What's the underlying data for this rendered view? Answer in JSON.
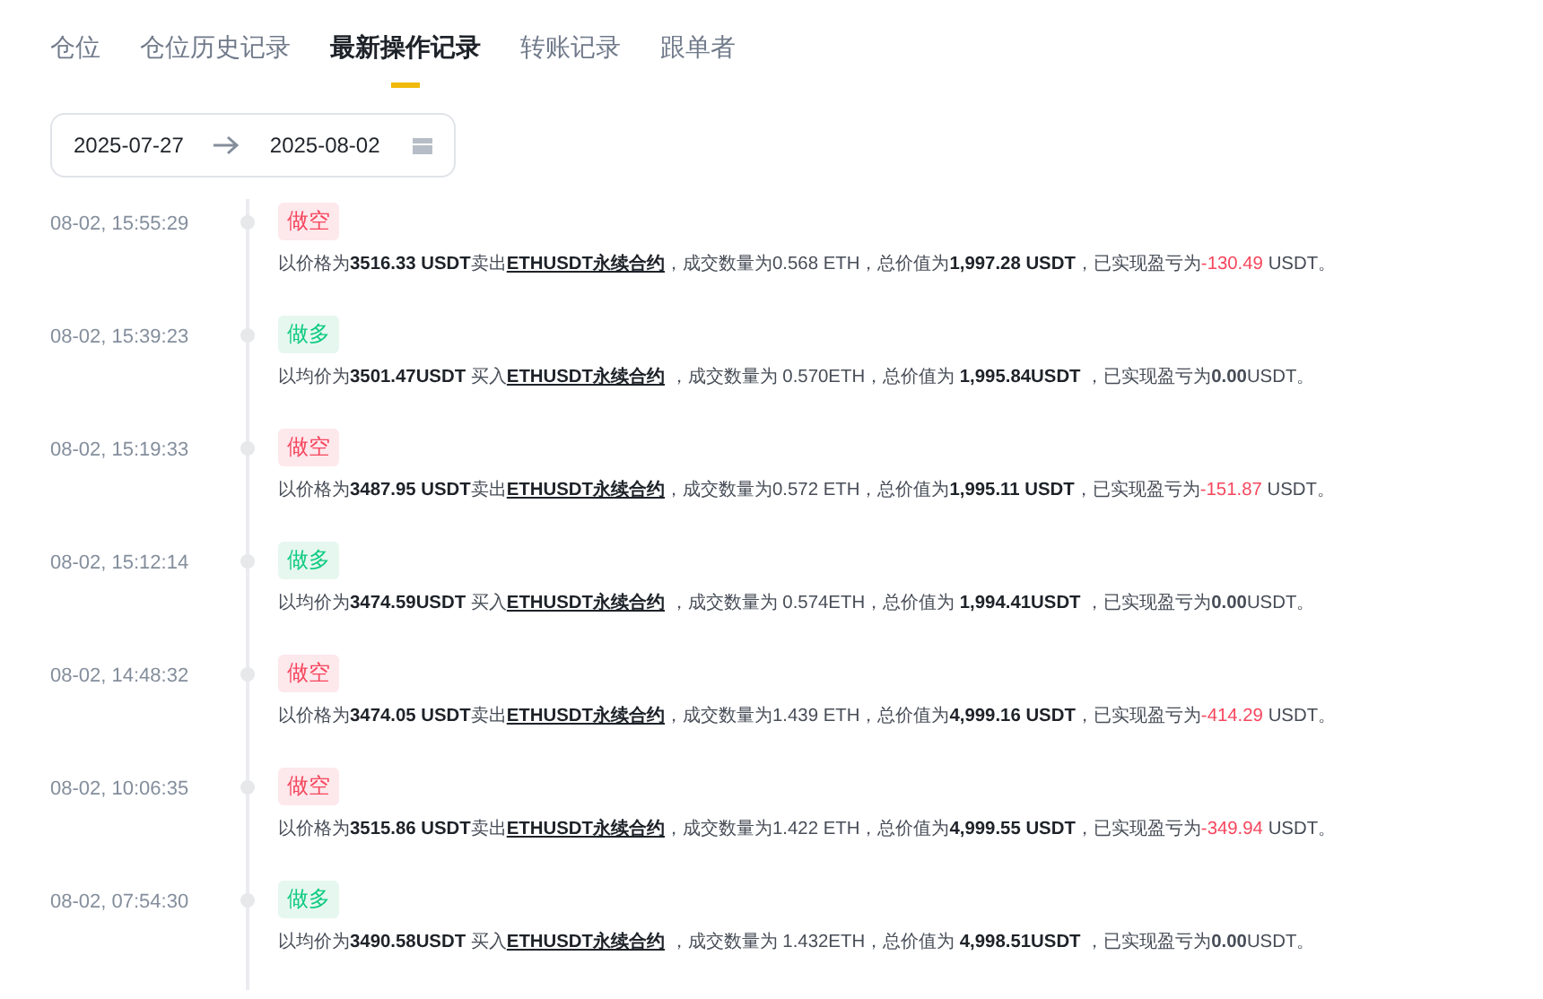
{
  "tabs": [
    {
      "label": "仓位",
      "selected": false
    },
    {
      "label": "仓位历史记录",
      "selected": false
    },
    {
      "label": "最新操作记录",
      "selected": true
    },
    {
      "label": "转账记录",
      "selected": false
    },
    {
      "label": "跟单者",
      "selected": false
    }
  ],
  "date_range": {
    "start": "2025-07-27",
    "end": "2025-08-02"
  },
  "records": [
    {
      "time": "08-02, 15:55:29",
      "kind": "short",
      "tag": "做空",
      "before": "以价格为**3516.33 USDT**卖出",
      "link": "ETHUSDT永续合约",
      "middle": "，成交数量为0.568 ETH，总价值为**1,997.28 USDT**，已实现盈亏为",
      "pnl": "-130.49",
      "loss": true,
      "after": " USDT。"
    },
    {
      "time": "08-02, 15:39:23",
      "kind": "long",
      "tag": "做多",
      "before": "以均价为**3501.47USDT** 买入",
      "link": "ETHUSDT永续合约",
      "middle": " ，成交数量为 0.570ETH，总价值为 **1,995.84USDT** ，已实现盈亏为",
      "pnl": "0.00",
      "loss": false,
      "after": "USDT。"
    },
    {
      "time": "08-02, 15:19:33",
      "kind": "short",
      "tag": "做空",
      "before": "以价格为**3487.95 USDT**卖出",
      "link": "ETHUSDT永续合约",
      "middle": "，成交数量为0.572 ETH，总价值为**1,995.11 USDT**，已实现盈亏为",
      "pnl": "-151.87",
      "loss": true,
      "after": " USDT。"
    },
    {
      "time": "08-02, 15:12:14",
      "kind": "long",
      "tag": "做多",
      "before": "以均价为**3474.59USDT** 买入",
      "link": "ETHUSDT永续合约",
      "middle": " ，成交数量为 0.574ETH，总价值为 **1,994.41USDT** ，已实现盈亏为",
      "pnl": "0.00",
      "loss": false,
      "after": "USDT。"
    },
    {
      "time": "08-02, 14:48:32",
      "kind": "short",
      "tag": "做空",
      "before": "以价格为**3474.05 USDT**卖出",
      "link": "ETHUSDT永续合约",
      "middle": "，成交数量为1.439 ETH，总价值为**4,999.16 USDT**，已实现盈亏为",
      "pnl": "-414.29",
      "loss": true,
      "after": " USDT。"
    },
    {
      "time": "08-02, 10:06:35",
      "kind": "short",
      "tag": "做空",
      "before": "以价格为**3515.86 USDT**卖出",
      "link": "ETHUSDT永续合约",
      "middle": "，成交数量为1.422 ETH，总价值为**4,999.55 USDT**，已实现盈亏为",
      "pnl": "-349.94",
      "loss": true,
      "after": " USDT。"
    },
    {
      "time": "08-02, 07:54:30",
      "kind": "long",
      "tag": "做多",
      "before": "以均价为**3490.58USDT** 买入",
      "link": "ETHUSDT永续合约",
      "middle": " ，成交数量为 1.432ETH，总价值为 **4,998.51USDT** ，已实现盈亏为",
      "pnl": "0.00",
      "loss": false,
      "after": "USDT。"
    }
  ]
}
